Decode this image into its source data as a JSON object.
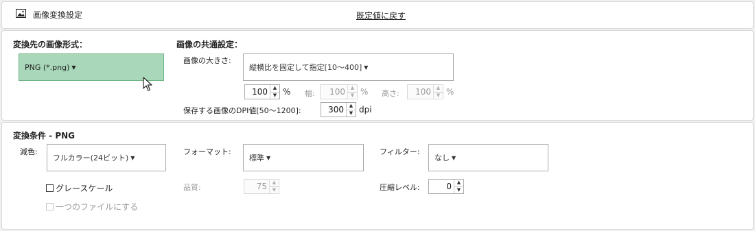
{
  "header": {
    "title": "画像変換設定",
    "reset_link": "既定値に戻す",
    "icon": "image-icon"
  },
  "format_section": {
    "title": "変換先の画像形式：",
    "format_value": "PNG (*.png)",
    "accent_color": "#a8d8b9"
  },
  "common_section": {
    "title": "画像の共通設定：",
    "size_label": "画像の大きさ:",
    "size_mode_value": "縦横比を固定して指定[10～400]",
    "percent_value": "100",
    "percent_unit": "%",
    "width_label": "幅:",
    "width_value": "100",
    "width_unit": "%",
    "height_label": "高さ:",
    "height_value": "100",
    "height_unit": "%",
    "dpi_label": "保存する画像のDPI値[50～1200]:",
    "dpi_value": "300",
    "dpi_unit": "dpi"
  },
  "conditions_section": {
    "title": "変換条件 - PNG",
    "color_reduction_label": "減色:",
    "color_reduction_value": "フルカラー(24ビット)",
    "grayscale_label": "グレースケール",
    "single_file_label": "一つのファイルにする",
    "format_label": "フォーマット:",
    "format_value": "標準",
    "quality_label": "品質:",
    "quality_value": "75",
    "filter_label": "フィルター:",
    "filter_value": "なし",
    "compression_label": "圧縮レベル:",
    "compression_value": "0"
  }
}
